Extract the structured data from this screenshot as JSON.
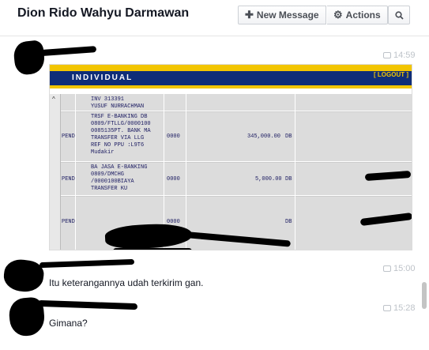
{
  "header": {
    "title": "Dion Rido Wahyu Darmawan",
    "new_message_label": "New Message",
    "actions_label": "Actions",
    "new_message_icon": "plus-icon",
    "actions_icon": "gear-icon",
    "search_icon": "search-icon"
  },
  "messages": [
    {
      "time": "14:59",
      "attachment": {
        "header": "INDIVIDUAL",
        "logout": "[ LOGOUT ]",
        "rows": [
          {
            "status": "",
            "desc": "INV 313391\nYUSUF NURRACHMAN",
            "code": "",
            "amount": "",
            "type": ""
          },
          {
            "status": "PEND",
            "desc": "TRSF E-BANKING DB\n0809/FTLLG/0000100\n0085135PT. BANK MA\nTRANSFER VIA LLG\nREF NO PPU :L9T6\nMudakir",
            "code": "0000",
            "amount": "345,000.00",
            "type": "DB"
          },
          {
            "status": "PEND",
            "desc": "BA JASA E-BANKING\n0809/DMCHG\n/0000100BIAYA\nTRANSFER KU",
            "code": "0000",
            "amount": "5,000.00",
            "type": "DB"
          },
          {
            "status": "PEND",
            "desc": "",
            "code": "0000",
            "amount": "",
            "type": "DB"
          }
        ]
      }
    },
    {
      "time": "15:00",
      "text": "Itu keterangannya udah terkirim gan."
    },
    {
      "time": "15:28",
      "text": "Gimana?"
    }
  ]
}
